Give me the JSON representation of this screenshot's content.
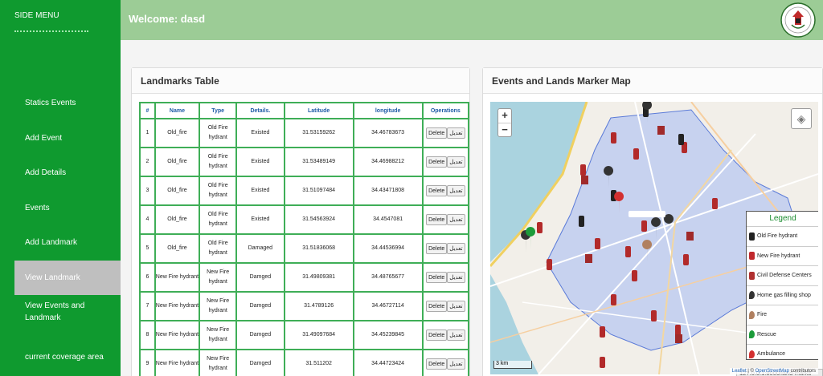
{
  "sidebar": {
    "title": "SIDE MENU",
    "items": [
      {
        "label": "Statics Events"
      },
      {
        "label": "Add Event"
      },
      {
        "label": "Add Details"
      },
      {
        "label": "Events"
      },
      {
        "label": "Add Landmark"
      },
      {
        "label": "View Landmark"
      },
      {
        "label": "View Events and Landmark"
      },
      {
        "label": "current coverage area"
      }
    ]
  },
  "header": {
    "title": "Welcome: dasd"
  },
  "table_panel": {
    "title": "Landmarks Table",
    "columns": [
      "#",
      "Name",
      "Type",
      "Details.",
      "Latitude",
      "longitude",
      "Operations"
    ],
    "delete_label": "Delete",
    "edit_label": "تعديل",
    "rows": [
      {
        "num": "1",
        "name": "Old_fire",
        "type": "Old Fire hydrant",
        "details": "Existed",
        "lat": "31.53159262",
        "lng": "34.46783673"
      },
      {
        "num": "2",
        "name": "Old_fire",
        "type": "Old Fire hydrant",
        "details": "Existed",
        "lat": "31.53489149",
        "lng": "34.46988212"
      },
      {
        "num": "3",
        "name": "Old_fire",
        "type": "Old Fire hydrant",
        "details": "Existed",
        "lat": "31.51097484",
        "lng": "34.43471808"
      },
      {
        "num": "4",
        "name": "Old_fire",
        "type": "Old Fire hydrant",
        "details": "Existed",
        "lat": "31.54563924",
        "lng": "34.4547081"
      },
      {
        "num": "5",
        "name": "Old_fire",
        "type": "Old Fire hydrant",
        "details": "Damaged",
        "lat": "31.51836068",
        "lng": "34.44536994"
      },
      {
        "num": "6",
        "name": "New Fire hydrant",
        "type": "New Fire hydrant",
        "details": "Damged",
        "lat": "31.49809381",
        "lng": "34.48765677"
      },
      {
        "num": "7",
        "name": "New Fire hydrant",
        "type": "New Fire hydrant",
        "details": "Damged",
        "lat": "31.4789126",
        "lng": "34.46727114"
      },
      {
        "num": "8",
        "name": "New Fire hydrant",
        "type": "New Fire hydrant",
        "details": "Damged",
        "lat": "31.49097684",
        "lng": "34.45239845"
      },
      {
        "num": "9",
        "name": "New Fire hydrant",
        "type": "New Fire hydrant",
        "details": "Damged",
        "lat": "31.511202",
        "lng": "34.44723424"
      }
    ]
  },
  "map_panel": {
    "title": "Events and Lands Marker Map",
    "zoom_in": "+",
    "zoom_out": "−",
    "scale": "3 km",
    "attribution_leaflet": "Leaflet",
    "attribution_sep": " | © ",
    "attribution_osm": "OpenStreetMap",
    "attribution_tail": " contributors",
    "legend": {
      "title": "Legend",
      "items": [
        {
          "label": "Old Fire hydrant",
          "icon": "hydrant-dark-icon",
          "color": "#222222"
        },
        {
          "label": "New Fire hydrant",
          "icon": "hydrant-red-icon",
          "color": "#c0282d"
        },
        {
          "label": "Civil Defense Centers",
          "icon": "building-icon",
          "color": "#b03030"
        },
        {
          "label": "Home gas filling shop",
          "icon": "pin-dark-icon",
          "color": "#333333"
        },
        {
          "label": "Fire",
          "icon": "pin-brown-icon",
          "color": "#b08060"
        },
        {
          "label": "Rescue",
          "icon": "pin-green-icon",
          "color": "#1c9b3a"
        },
        {
          "label": "Ambulance",
          "icon": "pin-red-icon",
          "color": "#d23030"
        }
      ]
    }
  },
  "statusbar": {
    "url": "127.0.0.1:8000/land-marks"
  },
  "colors": {
    "sidebar": "#0f9a2f",
    "header": "#9ccc96",
    "table_border": "#3fae57",
    "header_text": "#1d5aa6"
  }
}
